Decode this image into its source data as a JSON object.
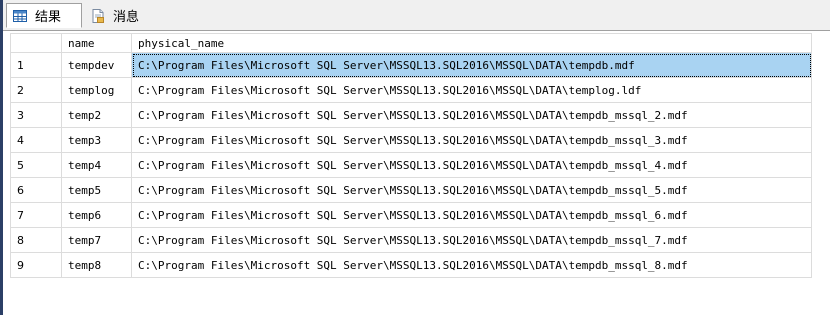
{
  "tabs": [
    {
      "label": "结果",
      "icon": "results-grid-icon",
      "active": true
    },
    {
      "label": "消息",
      "icon": "messages-icon",
      "active": false
    }
  ],
  "grid": {
    "columns": [
      "",
      "name",
      "physical_name"
    ],
    "rows": [
      {
        "num": "1",
        "name": "tempdev",
        "physical_name": "C:\\Program Files\\Microsoft SQL Server\\MSSQL13.SQL2016\\MSSQL\\DATA\\tempdb.mdf"
      },
      {
        "num": "2",
        "name": "templog",
        "physical_name": "C:\\Program Files\\Microsoft SQL Server\\MSSQL13.SQL2016\\MSSQL\\DATA\\templog.ldf"
      },
      {
        "num": "3",
        "name": "temp2",
        "physical_name": "C:\\Program Files\\Microsoft SQL Server\\MSSQL13.SQL2016\\MSSQL\\DATA\\tempdb_mssql_2.mdf"
      },
      {
        "num": "4",
        "name": "temp3",
        "physical_name": "C:\\Program Files\\Microsoft SQL Server\\MSSQL13.SQL2016\\MSSQL\\DATA\\tempdb_mssql_3.mdf"
      },
      {
        "num": "5",
        "name": "temp4",
        "physical_name": "C:\\Program Files\\Microsoft SQL Server\\MSSQL13.SQL2016\\MSSQL\\DATA\\tempdb_mssql_4.mdf"
      },
      {
        "num": "6",
        "name": "temp5",
        "physical_name": "C:\\Program Files\\Microsoft SQL Server\\MSSQL13.SQL2016\\MSSQL\\DATA\\tempdb_mssql_5.mdf"
      },
      {
        "num": "7",
        "name": "temp6",
        "physical_name": "C:\\Program Files\\Microsoft SQL Server\\MSSQL13.SQL2016\\MSSQL\\DATA\\tempdb_mssql_6.mdf"
      },
      {
        "num": "8",
        "name": "temp7",
        "physical_name": "C:\\Program Files\\Microsoft SQL Server\\MSSQL13.SQL2016\\MSSQL\\DATA\\tempdb_mssql_7.mdf"
      },
      {
        "num": "9",
        "name": "temp8",
        "physical_name": "C:\\Program Files\\Microsoft SQL Server\\MSSQL13.SQL2016\\MSSQL\\DATA\\tempdb_mssql_8.mdf"
      }
    ],
    "selected_row": "1"
  },
  "colors": {
    "selection": "#a9d3f2",
    "left_edge": "#2b3f66",
    "tab_bar": "#f0f0f0"
  }
}
